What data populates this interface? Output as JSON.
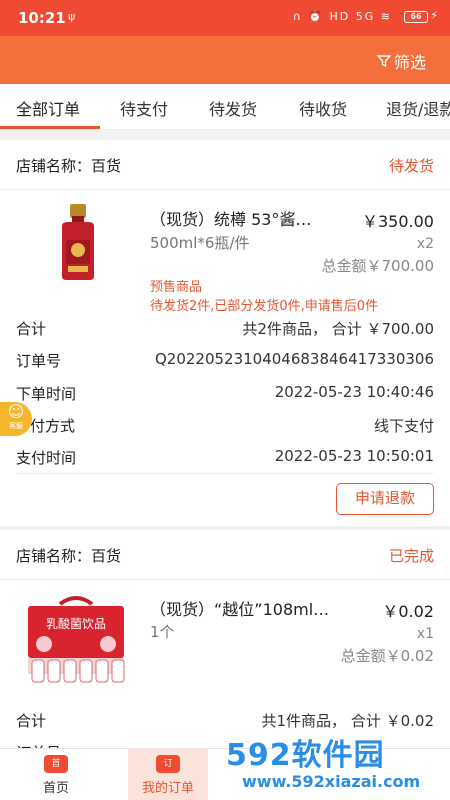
{
  "status_bar": {
    "time": "10:21",
    "battery": "66"
  },
  "header": {
    "filter_label": "筛选"
  },
  "tabs": [
    "全部订单",
    "待支付",
    "待发货",
    "待收货",
    "退货/退款"
  ],
  "orders": [
    {
      "shop_label": "店铺名称：百货",
      "status": "待发货",
      "product_title": "（现货）统樽 53°酱…",
      "price": "￥350.00",
      "spec": "500ml*6瓶/件",
      "qty": "x2",
      "total": "总金额￥700.00",
      "presale": "预售商品",
      "ship_info": "待发货2件,已部分发货0件,申请售后0件",
      "summary_label": "合计",
      "summary_value": "共2件商品， 合计 ￥700.00",
      "order_no_label": "订单号",
      "order_no": "Q20220523104046838464173303​06",
      "order_time_label": "下单时间",
      "order_time": "2022-05-23 10:40:46",
      "pay_method_label": "付方式",
      "pay_method": "线下支付",
      "pay_time_label": "支付时间",
      "pay_time": "2022-05-23 10:50:01",
      "action": "申请退款"
    },
    {
      "shop_label": "店铺名称：百货",
      "status": "已完成",
      "product_title": "（现货）“越位”108ml…",
      "price": "￥0.02",
      "spec": "1个",
      "qty": "x1",
      "total": "总金额￥0.02",
      "summary_label": "合计",
      "summary_value": "共1件商品， 合计 ￥0.02",
      "order_no_label": "订单号"
    }
  ],
  "float_button": {
    "label": "客服"
  },
  "bottom_nav": [
    {
      "label": "首页",
      "icon": "home-icon"
    },
    {
      "label": "我的订单",
      "icon": "orders-icon"
    }
  ],
  "watermark": {
    "big": "592软件园",
    "small": "www.592xiazai.com"
  }
}
